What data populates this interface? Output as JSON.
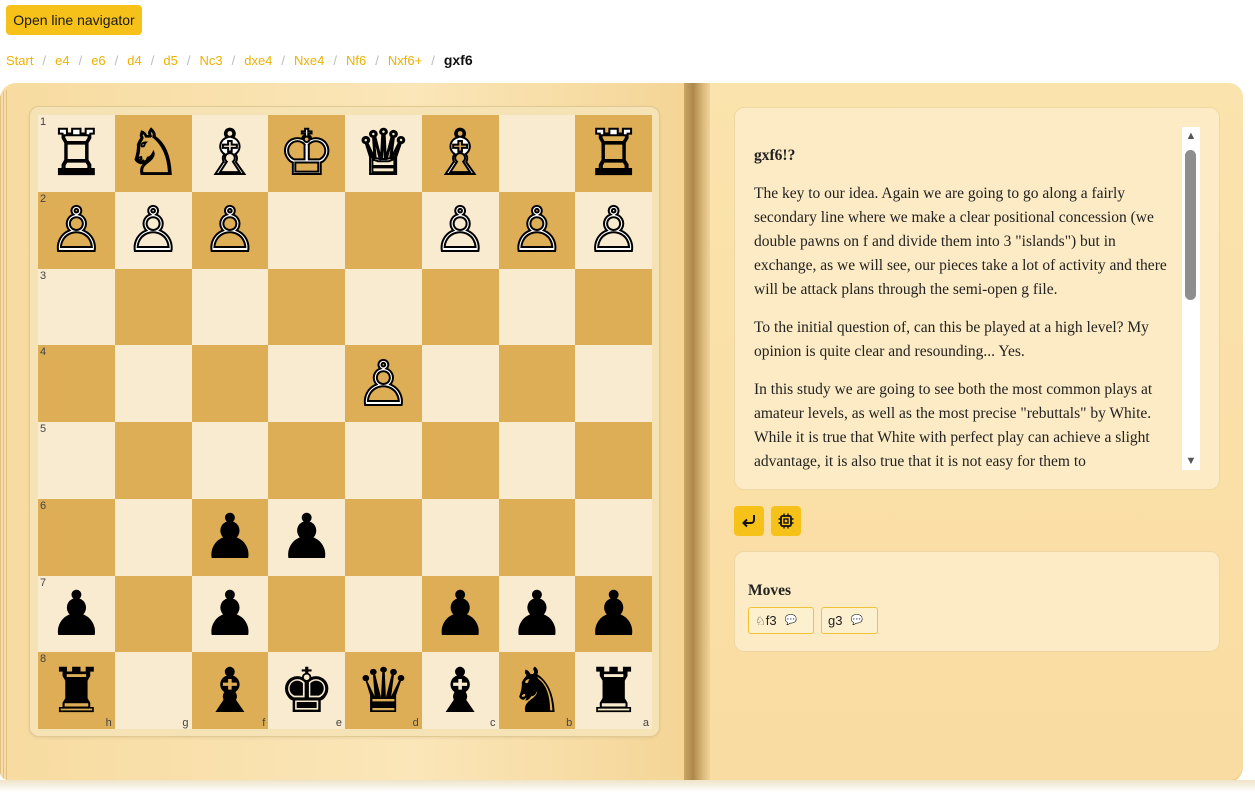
{
  "nav_button": "Open line navigator",
  "breadcrumb": [
    "Start",
    "e4",
    "e6",
    "d4",
    "d5",
    "Nc3",
    "dxe4",
    "Nxe4",
    "Nf6",
    "Nxf6+",
    "gxf6"
  ],
  "board": {
    "rows": [
      {
        "rank": "1",
        "files_label": "",
        "pieces": [
          "♖w",
          "♘w",
          "♗w",
          "♔w",
          "♕w",
          "♗w",
          "",
          "♖w"
        ]
      },
      {
        "rank": "2",
        "pieces": [
          "♙w",
          "♙w",
          "♙w",
          "",
          "",
          "♙w",
          "♙w",
          "♙w"
        ]
      },
      {
        "rank": "3",
        "pieces": [
          "",
          "",
          "",
          "",
          "",
          "",
          "",
          ""
        ]
      },
      {
        "rank": "4",
        "pieces": [
          "",
          "",
          "",
          "",
          "♙w",
          "",
          "",
          ""
        ]
      },
      {
        "rank": "5",
        "pieces": [
          "",
          "",
          "",
          "",
          "",
          "",
          "",
          ""
        ]
      },
      {
        "rank": "6",
        "pieces": [
          "",
          "",
          "♟b",
          "♟b",
          "",
          "",
          "",
          ""
        ]
      },
      {
        "rank": "7",
        "pieces": [
          "♟b",
          "",
          "♟b",
          "",
          "",
          "♟b",
          "♟b",
          "♟b"
        ]
      },
      {
        "rank": "8",
        "pieces": [
          "♜b",
          "",
          "♝b",
          "♚b",
          "♛b",
          "♝b",
          "♞b",
          "♜b"
        ]
      }
    ],
    "file_labels": [
      "h",
      "g",
      "f",
      "e",
      "d",
      "c",
      "b",
      "a"
    ],
    "light_color": "#f9ebd0",
    "dark_color": "#deae56"
  },
  "comment": {
    "title": "gxf6!?",
    "paragraphs": [
      "The key to our idea. Again we are going to go along a fairly secondary line where we make a clear positional concession (we double pawns on f and divide them into 3 \"islands\") but in exchange, as we will see, our pieces take a lot of activity and there will be attack plans through the semi-open g file.",
      "To the initial question of, can this be played at a high level? My opinion is quite clear and resounding... Yes.",
      "In this study we are going to see both the most common plays at amateur levels, as well as the most precise \"rebuttals\" by White. While it is true that White with perfect play can achieve a slight advantage, it is also true that it is not easy for them to"
    ]
  },
  "tools": {
    "back_icon": "return-arrow-icon",
    "engine_icon": "engine-chip-icon"
  },
  "moves": {
    "title": "Moves",
    "items": [
      {
        "piece_icon": "♘",
        "label": "f3"
      },
      {
        "piece_icon": "",
        "label": "g3"
      }
    ]
  },
  "colors": {
    "accent": "#f6c21a",
    "link": "#efb100"
  }
}
